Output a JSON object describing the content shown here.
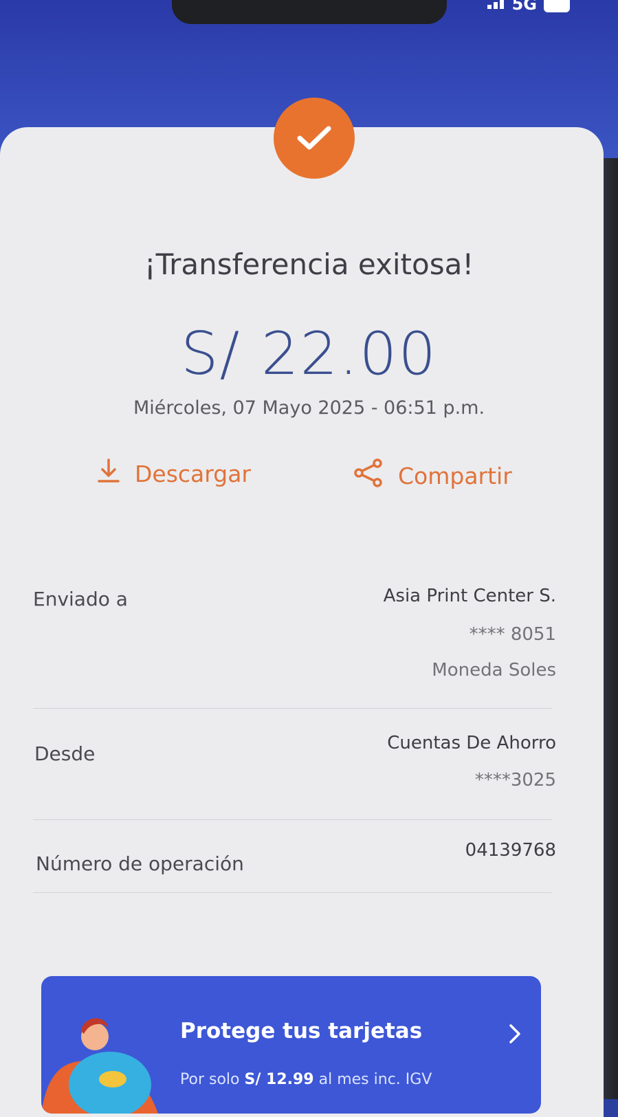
{
  "status_bar": {
    "network": "5G"
  },
  "receipt": {
    "title": "¡Transferencia exitosa!",
    "amount": "S/ 22.00",
    "datetime": "Miércoles, 07 Mayo 2025 - 06:51 p.m.",
    "actions": {
      "download": "Descargar",
      "share": "Compartir"
    }
  },
  "details": {
    "sent_to": {
      "label": "Enviado a",
      "name": "Asia Print Center S.",
      "account": "**** 8051",
      "currency": "Moneda Soles"
    },
    "from": {
      "label": "Desde",
      "account_type": "Cuentas De Ahorro",
      "account": "****3025"
    },
    "operation": {
      "label": "Número de operación",
      "number": "04139768"
    }
  },
  "promo": {
    "title": "Protege tus tarjetas",
    "subtitle_prefix": "Por solo",
    "price": "S/ 12.99",
    "subtitle_suffix": "al mes inc. IGV"
  },
  "colors": {
    "accent": "#e8732f",
    "amount": "#3a4f8f",
    "header_blue": "#2a3aa8",
    "promo_blue": "#3d57d6"
  }
}
